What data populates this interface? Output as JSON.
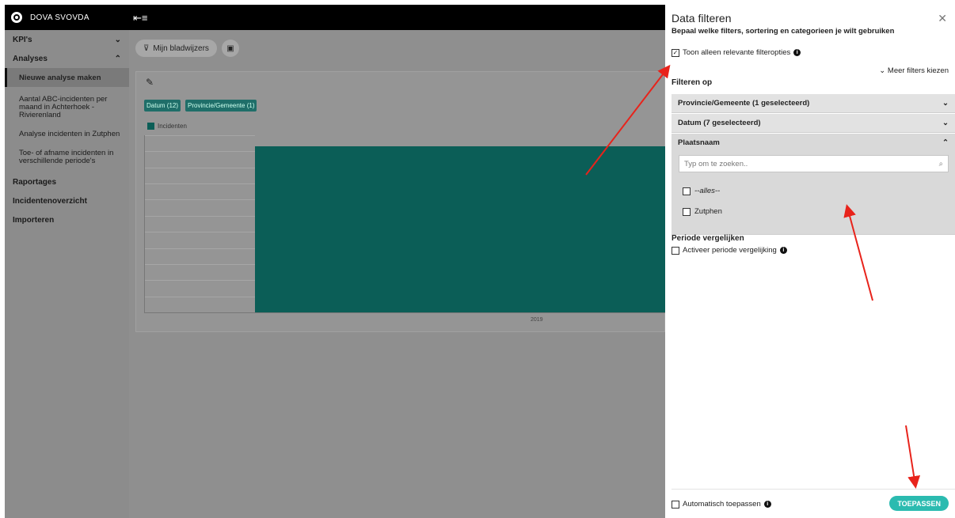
{
  "app": {
    "name": "DOVA SVOVDA"
  },
  "sidebar": {
    "items": [
      {
        "label": "KPI's",
        "chevron": "down"
      },
      {
        "label": "Analyses",
        "chevron": "up"
      },
      {
        "label": "Nieuwe analyse maken",
        "active": true
      },
      {
        "label": "Aantal ABC-incidenten per maand in Achterhoek - Rivierenland"
      },
      {
        "label": "Analyse incidenten in Zutphen"
      },
      {
        "label": "Toe- of afname incidenten in verschillende periode's"
      },
      {
        "label": "Raportages"
      },
      {
        "label": "Incidentenoverzicht"
      },
      {
        "label": "Importeren"
      }
    ]
  },
  "content": {
    "bookmarks_label": "Mijn bladwijzers",
    "chips": [
      "Datum (12)",
      "Provincie/Gemeente (1)"
    ],
    "legend_label": "Incidenten",
    "x_tick": "2019"
  },
  "chart_data": {
    "type": "bar",
    "categories": [
      "2019"
    ],
    "series": [
      {
        "name": "Incidenten",
        "values": [
          1
        ]
      }
    ],
    "title": "",
    "xlabel": "",
    "ylabel": "",
    "grid": true,
    "color": "#0b5e57"
  },
  "panel": {
    "title": "Data filteren",
    "subtitle": "Bepaal welke filters, sortering en categorieen je wilt gebruiken",
    "relevant_only_label": "Toon alleen relevante filteropties",
    "relevant_only_checked": true,
    "more_filters_label": "Meer filters kiezen",
    "filter_heading": "Filteren op",
    "accordions": [
      {
        "label": "Provincie/Gemeente (1 geselecteerd)",
        "open": false
      },
      {
        "label": "Datum (7 geselecteerd)",
        "open": false
      },
      {
        "label": "Plaatsnaam",
        "open": true
      }
    ],
    "search_placeholder": "Typ om te zoeken..",
    "options": [
      "--alles--",
      "Zutphen"
    ],
    "period_heading": "Periode vergelijken",
    "period_checkbox_label": "Activeer periode vergelijking",
    "auto_apply_label": "Automatisch toepassen",
    "apply_label": "TOEPASSEN"
  },
  "colors": {
    "accent": "#2bbbb0",
    "bar": "#0b5e57",
    "annotation_arrow": "#e8231b"
  }
}
